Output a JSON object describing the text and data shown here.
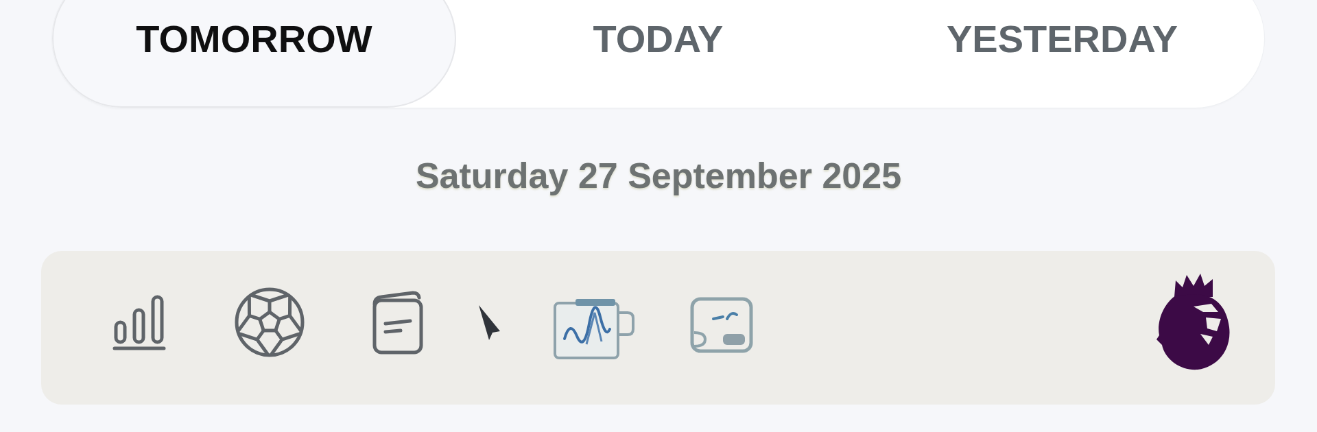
{
  "tabs": [
    {
      "label": "TOMORROW",
      "selected": true
    },
    {
      "label": "TODAY",
      "selected": false
    },
    {
      "label": "YESTERDAY",
      "selected": false
    }
  ],
  "date": {
    "heading": "Saturday 27 September 2025"
  }
}
